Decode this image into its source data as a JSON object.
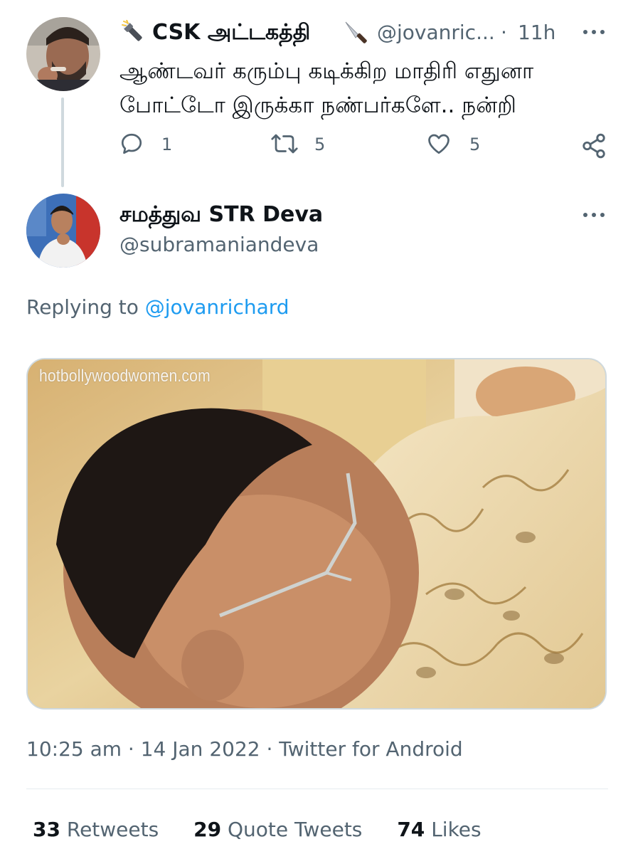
{
  "parent_tweet": {
    "display_name": "CSK அட்டகத்தி",
    "name_emoji_left": "flashlight-icon",
    "name_emoji_right": "knife-icon",
    "handle": "@jovanric...",
    "separator": "·",
    "time_ago": "11h",
    "text_line1": "ஆண்டவர் கரும்பு கடிக்கிற மாதிரி எதுனா",
    "text_line2": "போட்டோ இருக்கா நண்பர்களே.. நன்றி",
    "reply_count": "1",
    "retweet_count": "5",
    "like_count": "5"
  },
  "main_tweet": {
    "display_name": "சமத்துவ STR Deva",
    "handle": "@subramaniandeva",
    "replying_prefix": "Replying to",
    "replying_to": "@jovanrichard",
    "media_watermark": "hotbollywoodwomen.com",
    "timestamp": "10:25 am · 14 Jan 2022 · Twitter for Android",
    "retweets_count": "33",
    "retweets_label": "Retweets",
    "quote_count": "29",
    "quote_label": "Quote Tweets",
    "likes_count": "74",
    "likes_label": "Likes"
  },
  "colors": {
    "text_primary": "#0f1419",
    "text_secondary": "#536471",
    "link": "#1d9bf0",
    "border": "#cfd9de"
  }
}
